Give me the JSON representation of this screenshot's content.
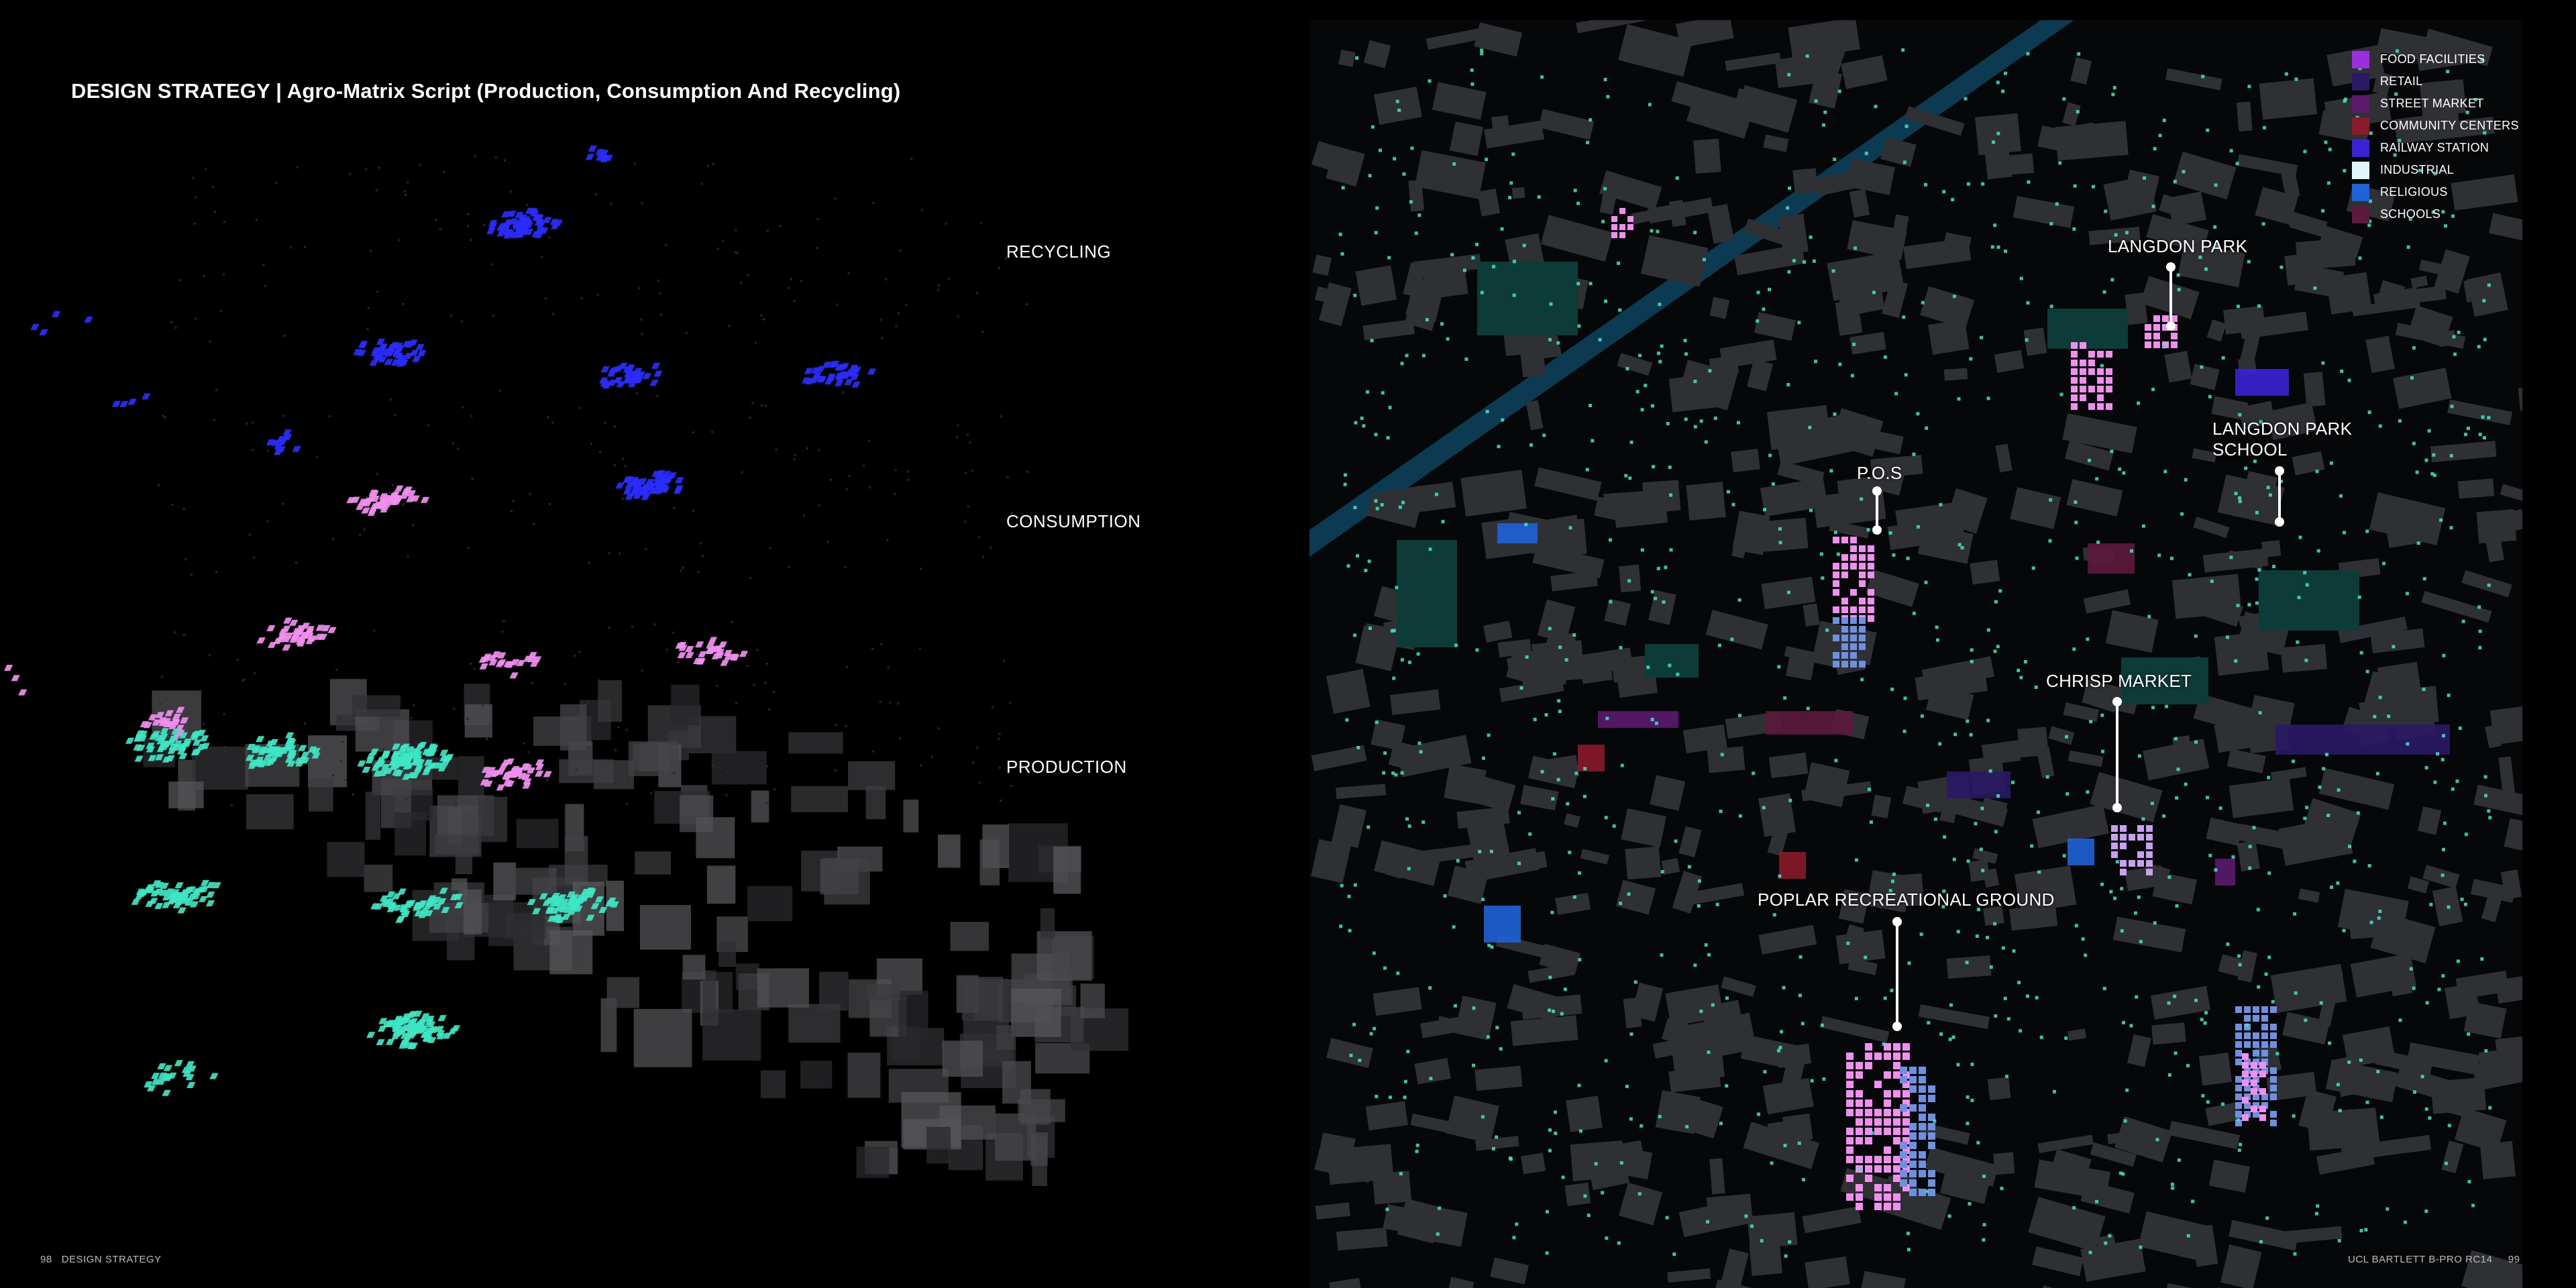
{
  "title": "DESIGN STRATEGY | Agro-Matrix Script (Production, Consumption And Recycling)",
  "layers": {
    "recycling": "RECYCLING",
    "consumption": "CONSUMPTION",
    "production": "PRODUCTION"
  },
  "footer": {
    "left_page": "98",
    "left_section": "DESIGN STRATEGY",
    "right_source": "UCL BARTLETT B-PRO RC14",
    "right_page": "99"
  },
  "legend": [
    {
      "label": "FOOD FACILITIES",
      "color": "#9b2fe0"
    },
    {
      "label": "RETAIL",
      "color": "#2a1a66"
    },
    {
      "label": "STREET MARKET",
      "color": "#5c1a6e"
    },
    {
      "label": "COMMUNITY CENTERS",
      "color": "#8a1a2a"
    },
    {
      "label": "RAILWAY STATION",
      "color": "#3b22d6"
    },
    {
      "label": "INDUSTRIAL",
      "color": "#dff6fb"
    },
    {
      "label": "RELIGIOUS",
      "color": "#1f63d8"
    },
    {
      "label": "SCHOOLS",
      "color": "#5e1a3c"
    }
  ],
  "callouts": {
    "langdon_park": "LANGDON PARK",
    "langdon_park_school_1": "LANGDON PARK",
    "langdon_park_school_2": "SCHOOL",
    "pos": "P.O.S",
    "chrisp_market": "CHRISP MARKET",
    "poplar_ground": "POPLAR RECREATIONAL GROUND"
  },
  "colors": {
    "production": "#3ee6c4",
    "consumption": "#f28ef2",
    "recycling": "#2a2cff",
    "building": "#2f3033",
    "canal": "#0c3a52",
    "green_space": "#0d3b38"
  }
}
